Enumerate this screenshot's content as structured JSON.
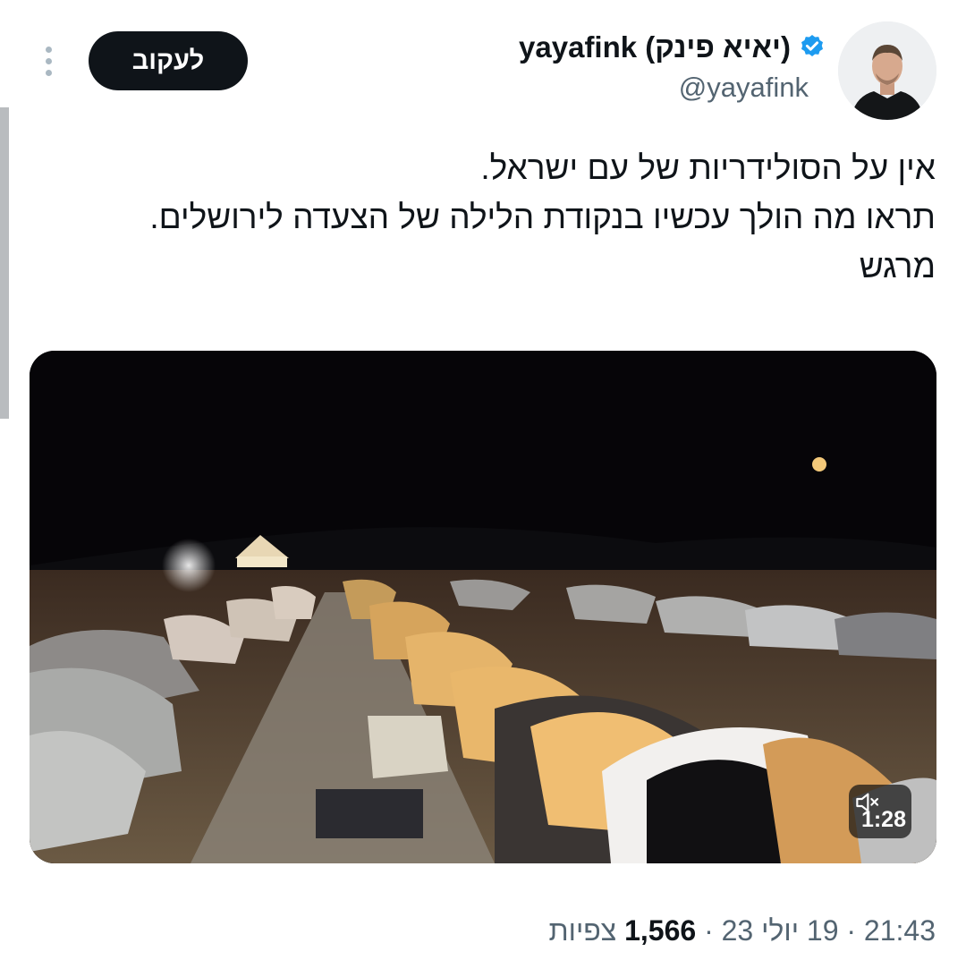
{
  "author": {
    "display_name": "yayafink (יאיא פינק)",
    "handle": "@yayafink",
    "verified": true,
    "verified_color": "#1d9bf0"
  },
  "follow_button": {
    "label": "לעקוב"
  },
  "more_icon": "more-vertical-icon",
  "tweet": {
    "lines": [
      "אין על הסולידריות של עם ישראל.",
      "תראו מה הולך עכשיו בנקודת הלילה של הצעדה לירושלים.",
      "מרגש"
    ]
  },
  "media": {
    "type": "video",
    "duration": "1:28",
    "mute_icon": "speaker-muted-icon"
  },
  "meta": {
    "time": "21:43",
    "separator": "·",
    "date": "19 יולי 23",
    "views_count": "1,566",
    "views_label": "צפיות"
  }
}
